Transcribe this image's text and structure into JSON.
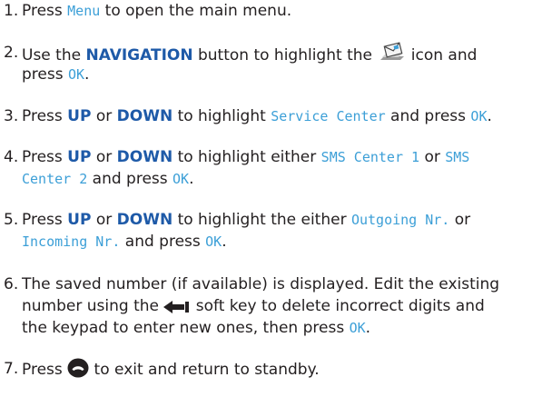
{
  "steps": [
    {
      "num": "1.",
      "l1a": "Press ",
      "menu": "Menu",
      "l1b": " to open the main menu."
    },
    {
      "num": "2.",
      "l1a": "Use the ",
      "navigation": "NAVIGATION",
      "l1b": " button to highlight the ",
      "icon": "messages-envelope-icon",
      "l1c": " icon and",
      "l2a": "press ",
      "ok": "OK",
      "l2b": "."
    },
    {
      "num": "3.",
      "l1a": "Press ",
      "up": "UP",
      "or": " or ",
      "down": "DOWN",
      "l1b": " to highlight ",
      "item": "Service Center",
      "l1c": " and press ",
      "ok": "OK",
      "l1d": "."
    },
    {
      "num": "4.",
      "l1a": "Press ",
      "up": "UP",
      "or": " or ",
      "down": "DOWN",
      "l1b": " to highlight either ",
      "item1": "SMS Center 1",
      "l1c": " or ",
      "item2a": "SMS",
      "item2b": "Center 2",
      "l2a": " and press ",
      "ok": "OK",
      "l2b": "."
    },
    {
      "num": "5.",
      "l1a": "Press ",
      "up": "UP",
      "or": " or ",
      "down": "DOWN",
      "l1b": " to highlight the either ",
      "item1": "Outgoing Nr.",
      "l1c": " or",
      "item2": "Incoming Nr.",
      "l2a": " and press ",
      "ok": "OK",
      "l2b": "."
    },
    {
      "num": "6.",
      "l1": "The saved number (if available) is displayed. Edit the existing",
      "l2a": "number using the ",
      "icon": "back-arrow-icon",
      "l2b": " soft key to delete incorrect digits and",
      "l3a": "the keypad to enter new ones, then press ",
      "ok": "OK",
      "l3b": "."
    },
    {
      "num": "7.",
      "l1a": "Press ",
      "icon": "end-call-icon",
      "l1b": " to exit and return to standby."
    }
  ],
  "colors": {
    "body_text": "#231f20",
    "keyword": "#1e5aa8",
    "display_text": "#3c9fd7"
  }
}
